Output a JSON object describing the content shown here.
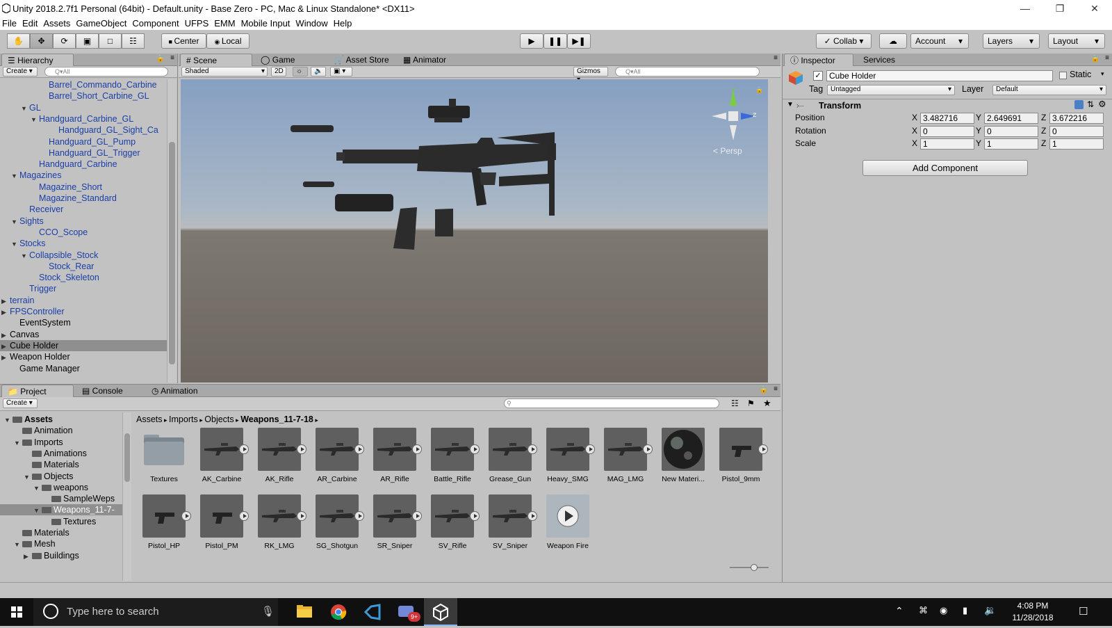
{
  "window": {
    "title": "Unity 2018.2.7f1 Personal (64bit) - Default.unity - Base Zero - PC, Mac & Linux Standalone* <DX11>"
  },
  "menu": [
    "File",
    "Edit",
    "Assets",
    "GameObject",
    "Component",
    "UFPS",
    "EMM",
    "Mobile Input",
    "Window",
    "Help"
  ],
  "toolbar": {
    "center": "Center",
    "local": "Local",
    "collab": "Collab",
    "account": "Account",
    "layers": "Layers",
    "layout": "Layout"
  },
  "hierarchy": {
    "tab": "Hierarchy",
    "create": "Create",
    "search_placeholder": "Q▾All",
    "items": [
      {
        "label": "Barrel_Commando_Carbine",
        "indent": 4,
        "arrow": "",
        "blue": true
      },
      {
        "label": "Barrel_Short_Carbine_GL",
        "indent": 4,
        "arrow": "",
        "blue": true
      },
      {
        "label": "GL",
        "indent": 2,
        "arrow": "▼",
        "blue": true
      },
      {
        "label": "Handguard_Carbine_GL",
        "indent": 3,
        "arrow": "▼",
        "blue": true
      },
      {
        "label": "Handguard_GL_Sight_Ca",
        "indent": 5,
        "arrow": "",
        "blue": true
      },
      {
        "label": "Handguard_GL_Pump",
        "indent": 4,
        "arrow": "",
        "blue": true
      },
      {
        "label": "Handguard_GL_Trigger",
        "indent": 4,
        "arrow": "",
        "blue": true
      },
      {
        "label": "Handguard_Carbine",
        "indent": 3,
        "arrow": "",
        "blue": true
      },
      {
        "label": "Magazines",
        "indent": 1,
        "arrow": "▼",
        "blue": true
      },
      {
        "label": "Magazine_Short",
        "indent": 3,
        "arrow": "",
        "blue": true
      },
      {
        "label": "Magazine_Standard",
        "indent": 3,
        "arrow": "",
        "blue": true
      },
      {
        "label": "Receiver",
        "indent": 2,
        "arrow": "",
        "blue": true
      },
      {
        "label": "Sights",
        "indent": 1,
        "arrow": "▼",
        "blue": true
      },
      {
        "label": "CCO_Scope",
        "indent": 3,
        "arrow": "",
        "blue": true
      },
      {
        "label": "Stocks",
        "indent": 1,
        "arrow": "▼",
        "blue": true
      },
      {
        "label": "Collapsible_Stock",
        "indent": 2,
        "arrow": "▼",
        "blue": true
      },
      {
        "label": "Stock_Rear",
        "indent": 4,
        "arrow": "",
        "blue": true
      },
      {
        "label": "Stock_Skeleton",
        "indent": 3,
        "arrow": "",
        "blue": true
      },
      {
        "label": "Trigger",
        "indent": 2,
        "arrow": "",
        "blue": true
      },
      {
        "label": "terrain",
        "indent": 0,
        "arrow": "▶",
        "blue": true
      },
      {
        "label": "FPSController",
        "indent": 0,
        "arrow": "▶",
        "blue": true
      },
      {
        "label": "EventSystem",
        "indent": 1,
        "arrow": "",
        "blue": false
      },
      {
        "label": "Canvas",
        "indent": 0,
        "arrow": "▶",
        "blue": false
      },
      {
        "label": "Cube Holder",
        "indent": 0,
        "arrow": "▶",
        "blue": false,
        "selected": true
      },
      {
        "label": "Weapon Holder",
        "indent": 0,
        "arrow": "▶",
        "blue": false
      },
      {
        "label": "Game Manager",
        "indent": 1,
        "arrow": "",
        "blue": false
      }
    ]
  },
  "scene": {
    "tabs": [
      "Scene",
      "Game",
      "Asset Store",
      "Animator"
    ],
    "shaded": "Shaded",
    "twod": "2D",
    "gizmos": "Gizmos",
    "search_placeholder": "Q▾All",
    "persp": "< Persp"
  },
  "inspector": {
    "tabs": [
      "Inspector",
      "Services"
    ],
    "object_name": "Cube Holder",
    "static_label": "Static",
    "tag_label": "Tag",
    "tag_value": "Untagged",
    "layer_label": "Layer",
    "layer_value": "Default",
    "component": "Transform",
    "rows": [
      {
        "label": "Position",
        "x": "3.482716",
        "y": "2.649691",
        "z": "3.672216"
      },
      {
        "label": "Rotation",
        "x": "0",
        "y": "0",
        "z": "0"
      },
      {
        "label": "Scale",
        "x": "1",
        "y": "1",
        "z": "1"
      }
    ],
    "add_component": "Add Component"
  },
  "project": {
    "tabs": [
      "Project",
      "Console",
      "Animation"
    ],
    "create": "Create",
    "breadcrumb": [
      "Assets",
      "Imports",
      "Objects",
      "Weapons_11-7-18"
    ],
    "tree": [
      {
        "label": "Assets",
        "indent": 0,
        "arrow": "▼",
        "bold": true
      },
      {
        "label": "Animation",
        "indent": 1,
        "arrow": ""
      },
      {
        "label": "Imports",
        "indent": 1,
        "arrow": "▼"
      },
      {
        "label": "Animations",
        "indent": 2,
        "arrow": ""
      },
      {
        "label": "Materials",
        "indent": 2,
        "arrow": ""
      },
      {
        "label": "Objects",
        "indent": 2,
        "arrow": "▼"
      },
      {
        "label": "weapons",
        "indent": 3,
        "arrow": "▼"
      },
      {
        "label": "SampleWeps",
        "indent": 4,
        "arrow": ""
      },
      {
        "label": "Weapons_11-7-",
        "indent": 3,
        "arrow": "▼",
        "selected": true
      },
      {
        "label": "Textures",
        "indent": 4,
        "arrow": ""
      },
      {
        "label": "Materials",
        "indent": 1,
        "arrow": ""
      },
      {
        "label": "Mesh",
        "indent": 1,
        "arrow": "▼"
      },
      {
        "label": "Buildings",
        "indent": 2,
        "arrow": "▶"
      }
    ],
    "assets": [
      {
        "label": "Textures",
        "kind": "folder"
      },
      {
        "label": "AK_Carbine",
        "kind": "gun"
      },
      {
        "label": "AK_Rifle",
        "kind": "gun"
      },
      {
        "label": "AR_Carbine",
        "kind": "gun"
      },
      {
        "label": "AR_Rifle",
        "kind": "gun"
      },
      {
        "label": "Battle_Rifle",
        "kind": "gun"
      },
      {
        "label": "Grease_Gun",
        "kind": "gun"
      },
      {
        "label": "Heavy_SMG",
        "kind": "gun"
      },
      {
        "label": "MAG_LMG",
        "kind": "gun"
      },
      {
        "label": "New Materi...",
        "kind": "material"
      },
      {
        "label": "Pistol_9mm",
        "kind": "pistol"
      },
      {
        "label": "Pistol_HP",
        "kind": "pistol"
      },
      {
        "label": "Pistol_PM",
        "kind": "pistol"
      },
      {
        "label": "RK_LMG",
        "kind": "gun"
      },
      {
        "label": "SG_Shotgun",
        "kind": "gun"
      },
      {
        "label": "SR_Sniper",
        "kind": "gun"
      },
      {
        "label": "SV_Rifle",
        "kind": "gun"
      },
      {
        "label": "SV_Sniper",
        "kind": "gun"
      },
      {
        "label": "Weapon Fire",
        "kind": "anim"
      }
    ]
  },
  "taskbar": {
    "search_placeholder": "Type here to search",
    "time": "4:08 PM",
    "date": "11/28/2018",
    "badge": "9+"
  }
}
